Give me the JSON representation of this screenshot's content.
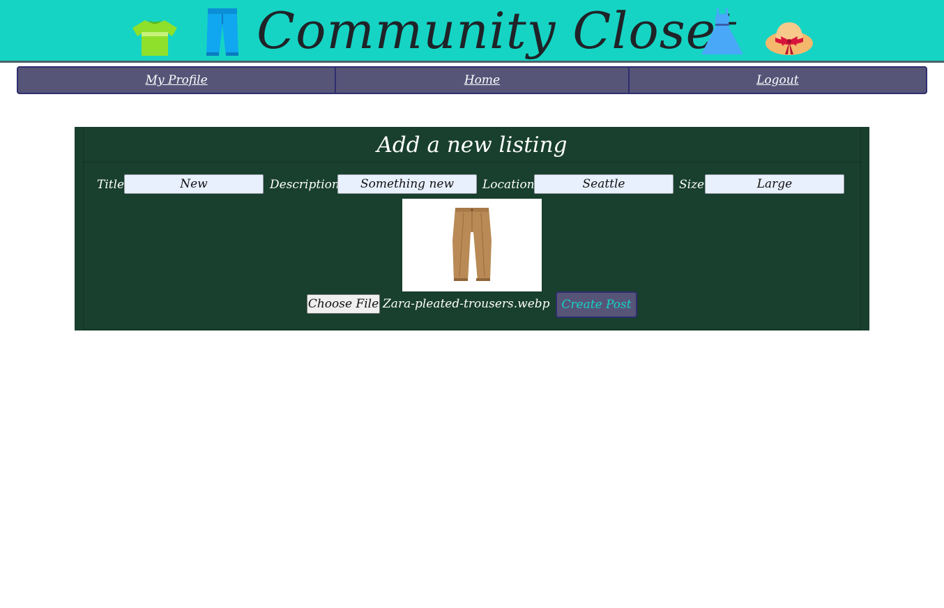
{
  "header": {
    "title": "Community Closet",
    "icons": [
      "tshirt-icon",
      "jeans-icon",
      "dress-icon",
      "sun-hat-icon"
    ],
    "background_color": "#15d4c4"
  },
  "nav": {
    "items": [
      {
        "label": "My Profile"
      },
      {
        "label": "Home"
      },
      {
        "label": "Logout"
      }
    ],
    "background_color": "#565578"
  },
  "form": {
    "heading": "Add a new listing",
    "fields": {
      "title": {
        "label": "Title",
        "value": "New"
      },
      "description": {
        "label": "Description",
        "value": "Something new"
      },
      "location": {
        "label": "Location",
        "value": "Seattle"
      },
      "size": {
        "label": "Size",
        "value": "Large"
      }
    },
    "file": {
      "button_label": "Choose File",
      "file_name": "Zara-pleated-trousers.webp"
    },
    "submit_label": "Create Post",
    "panel_color": "#193f2e"
  }
}
